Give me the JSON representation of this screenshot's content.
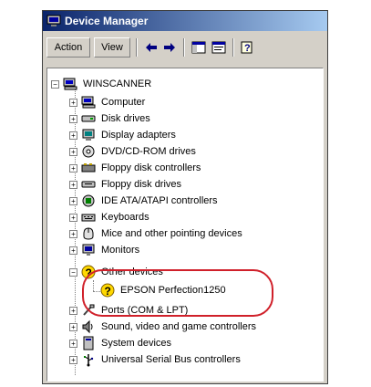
{
  "window": {
    "title": "Device Manager"
  },
  "toolbar": {
    "action_label": "Action",
    "view_label": "View"
  },
  "tree": {
    "root": "WINSCANNER",
    "items": [
      {
        "label": "Computer",
        "icon": "computer-icon"
      },
      {
        "label": "Disk drives",
        "icon": "disk-drive-icon"
      },
      {
        "label": "Display adapters",
        "icon": "display-adapter-icon"
      },
      {
        "label": "DVD/CD-ROM drives",
        "icon": "dvd-drive-icon"
      },
      {
        "label": "Floppy disk controllers",
        "icon": "floppy-controller-icon"
      },
      {
        "label": "Floppy disk drives",
        "icon": "floppy-drive-icon"
      },
      {
        "label": "IDE ATA/ATAPI controllers",
        "icon": "ide-controller-icon"
      },
      {
        "label": "Keyboards",
        "icon": "keyboard-icon"
      },
      {
        "label": "Mice and other pointing devices",
        "icon": "mouse-icon"
      },
      {
        "label": "Monitors",
        "icon": "monitor-icon"
      },
      {
        "label": "Other devices",
        "icon": "unknown-device-icon"
      },
      {
        "label": "EPSON Perfection1250",
        "icon": "unknown-device-icon"
      },
      {
        "label": "Ports (COM & LPT)",
        "icon": "port-icon"
      },
      {
        "label": "Sound, video and game controllers",
        "icon": "sound-icon"
      },
      {
        "label": "System devices",
        "icon": "system-device-icon"
      },
      {
        "label": "Universal Serial Bus controllers",
        "icon": "usb-icon"
      }
    ]
  },
  "colors": {
    "title_start": "#0a246a",
    "title_end": "#a6caf0",
    "highlight": "#d0202a"
  }
}
